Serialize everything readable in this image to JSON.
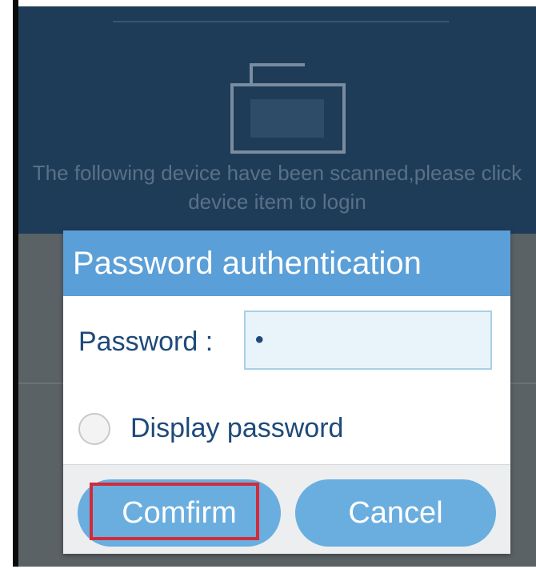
{
  "background": {
    "message": "The following device have been scanned,please click device item to login",
    "icon": "device-icon"
  },
  "dialog": {
    "title": "Password authentication",
    "password_label": "Password :",
    "password_value": "•",
    "display_password_label": "Display password",
    "display_password_checked": false,
    "confirm_label": "Comfirm",
    "cancel_label": "Cancel"
  },
  "colors": {
    "header_bg": "#1e3c58",
    "dialog_title_bg": "#5a9fd8",
    "button_bg": "#6aaee0",
    "label_text": "#1d4a7a",
    "highlight": "#d22b3a"
  }
}
